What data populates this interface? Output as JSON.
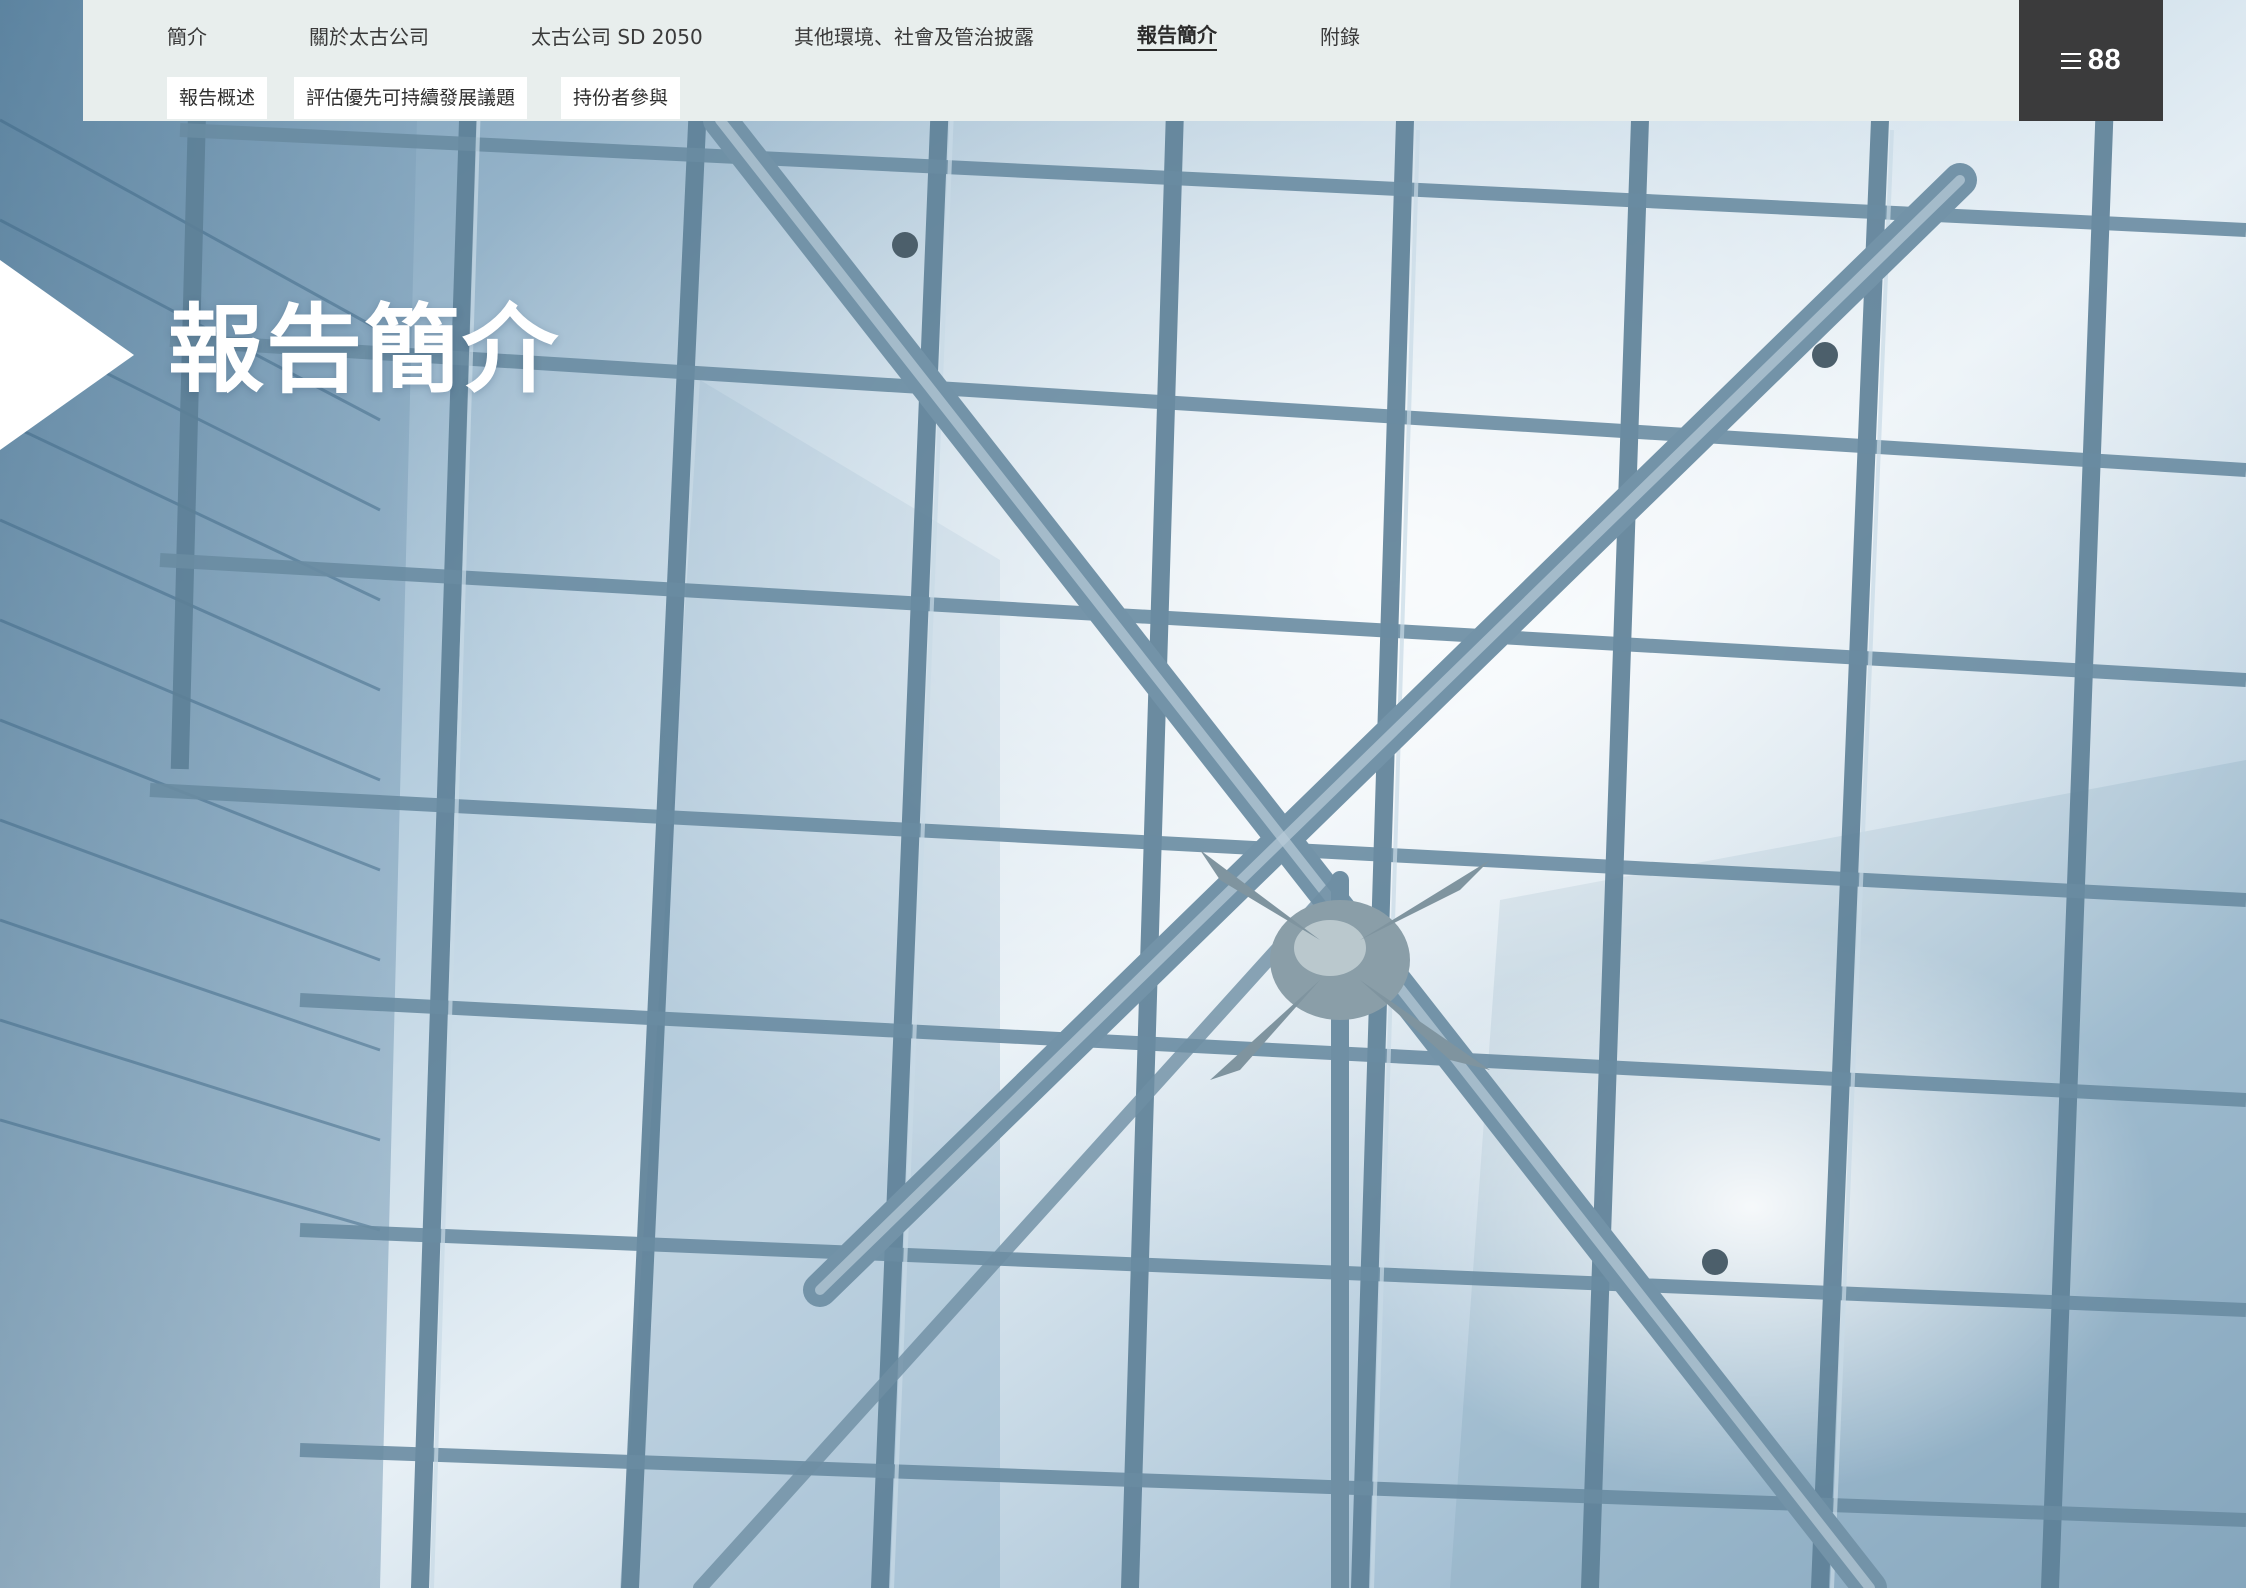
{
  "nav": {
    "items": [
      {
        "label": "簡介"
      },
      {
        "label": "關於太古公司"
      },
      {
        "label": "太古公司 SD 2050"
      },
      {
        "label": "其他環境、社會及管治披露"
      },
      {
        "label": "報告簡介"
      },
      {
        "label": "附錄"
      }
    ],
    "active_index": 4
  },
  "subnav": {
    "tabs": [
      {
        "label": "報告概述"
      },
      {
        "label": "評估優先可持續發展議題"
      },
      {
        "label": "持份者參與"
      }
    ]
  },
  "menu": {
    "icon": "hamburger-menu-icon",
    "page_number": "88"
  },
  "hero": {
    "title": "報告簡介",
    "background": "glass-atrium-photo",
    "colors": {
      "sky": "#dfeaf2",
      "frame": "#5b7f97",
      "glass": "#8fb0c8"
    }
  },
  "colors": {
    "nav_bg": "#e8eeed",
    "menu_bg": "#3b3b3c",
    "tab_bg": "#ffffff",
    "title": "#ffffff"
  }
}
